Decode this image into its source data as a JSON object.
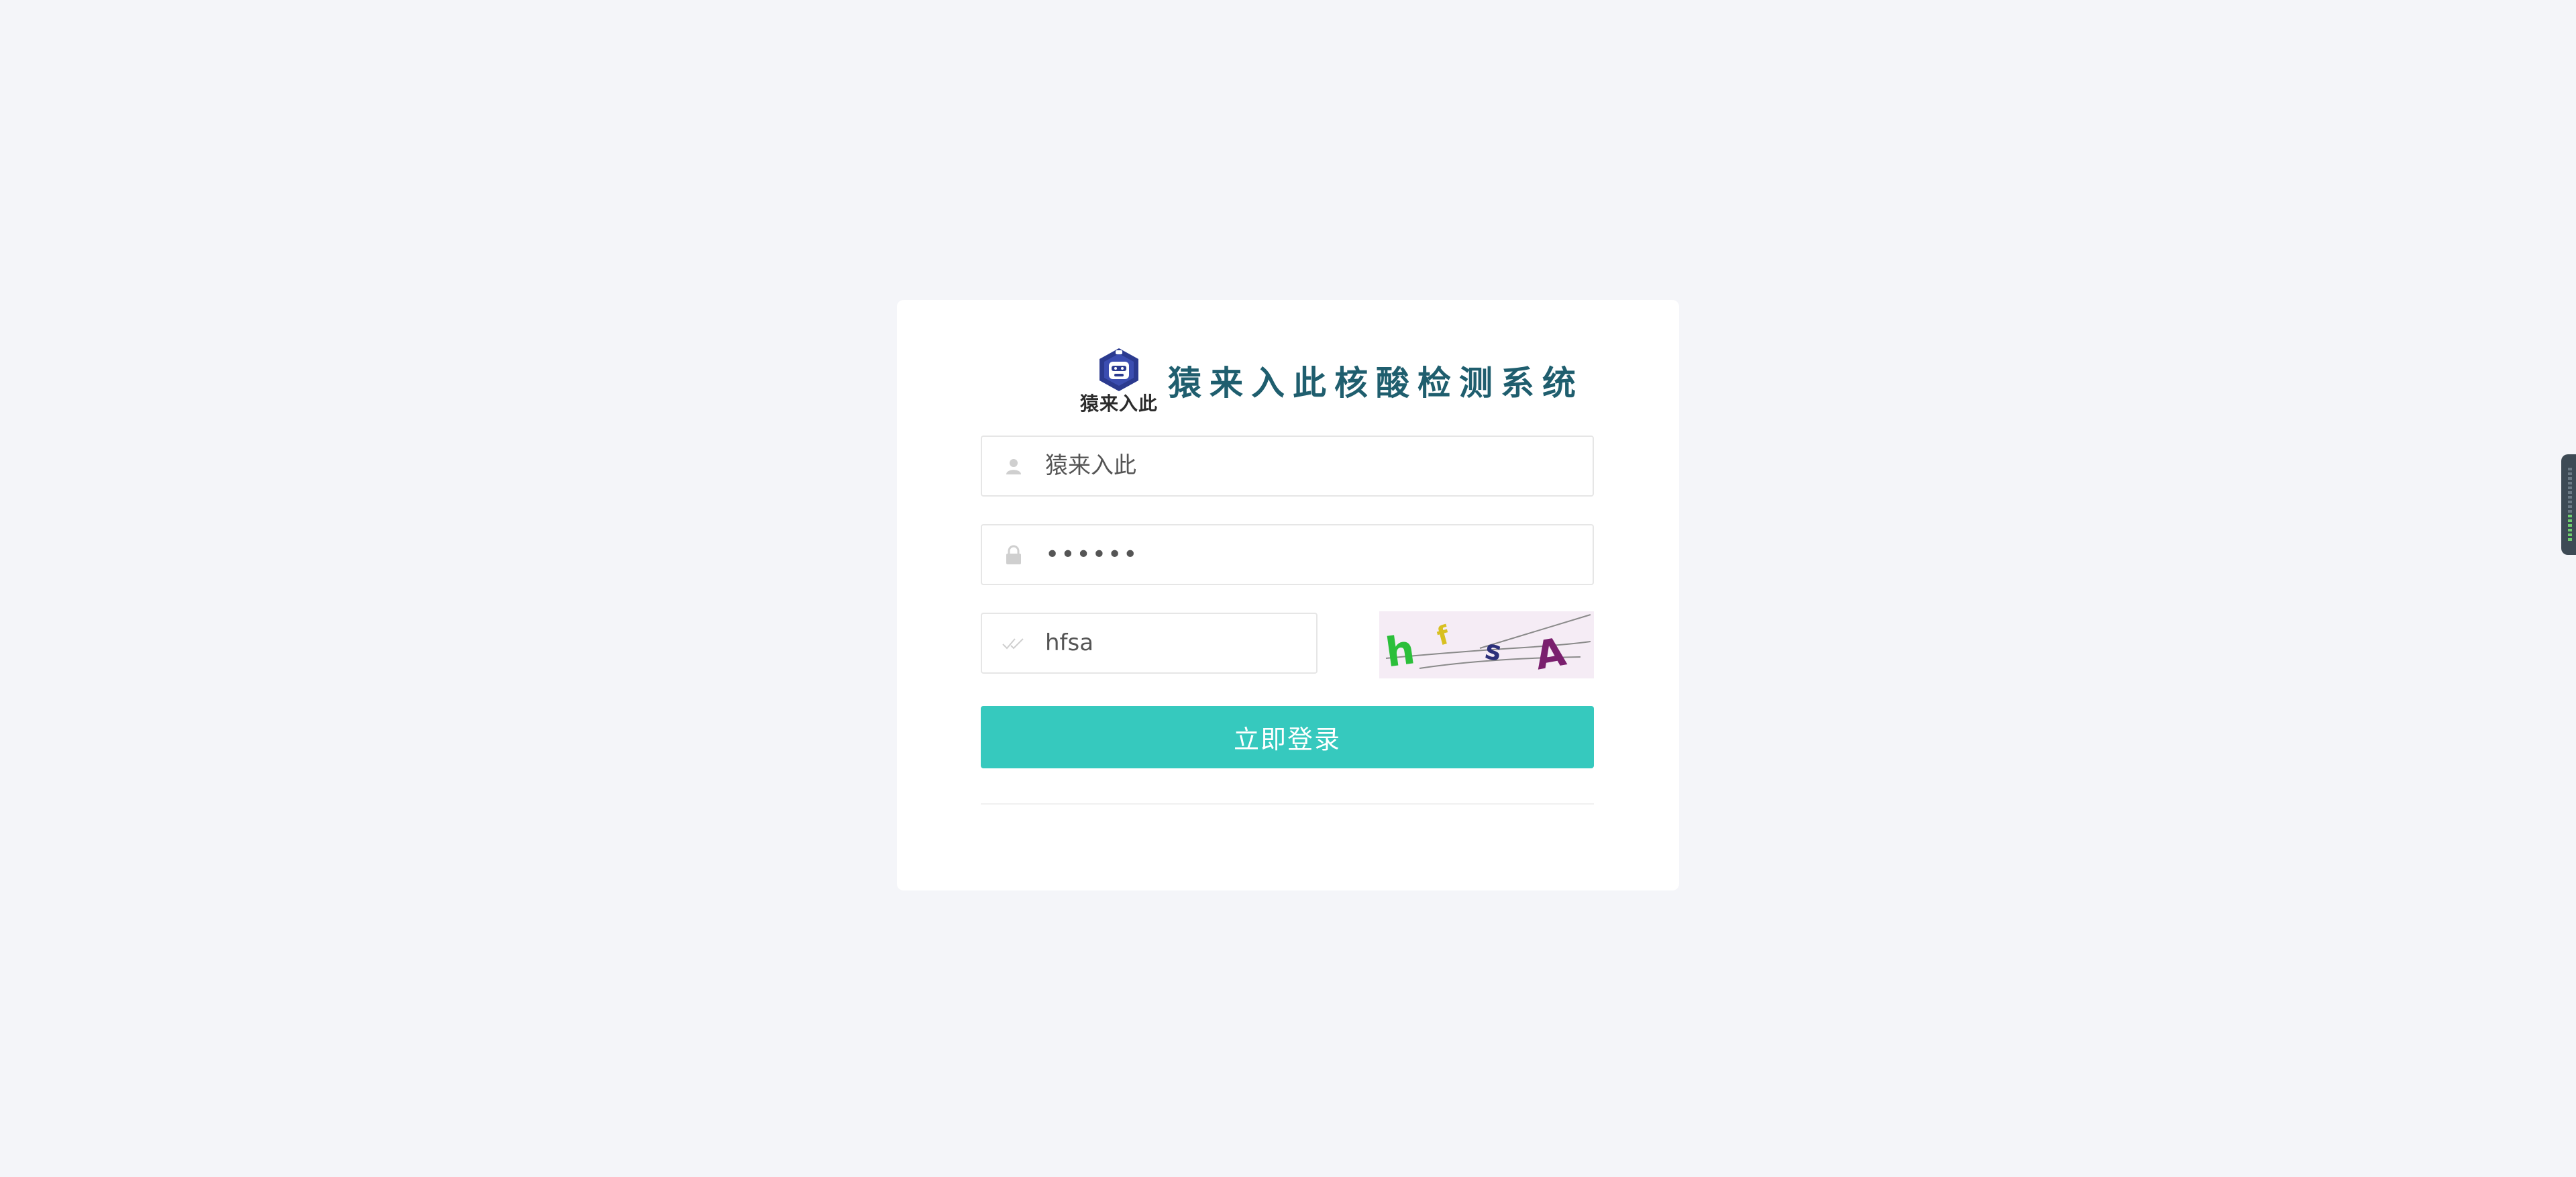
{
  "app": {
    "logo_text": "猿来入此",
    "title": "猿来入此核酸检测系统"
  },
  "form": {
    "username": {
      "value": "猿来入此",
      "icon": "user-icon"
    },
    "password": {
      "value": "••••••",
      "icon": "lock-icon"
    },
    "captcha": {
      "value": "hfsa",
      "icon": "check-icon",
      "image_text": "hfsA"
    },
    "submit_label": "立即登录"
  },
  "colors": {
    "background": "#f4f5f9",
    "button": "#36c9be",
    "title": "#1f5e6e",
    "logo_badge": "#2b3a8f"
  }
}
